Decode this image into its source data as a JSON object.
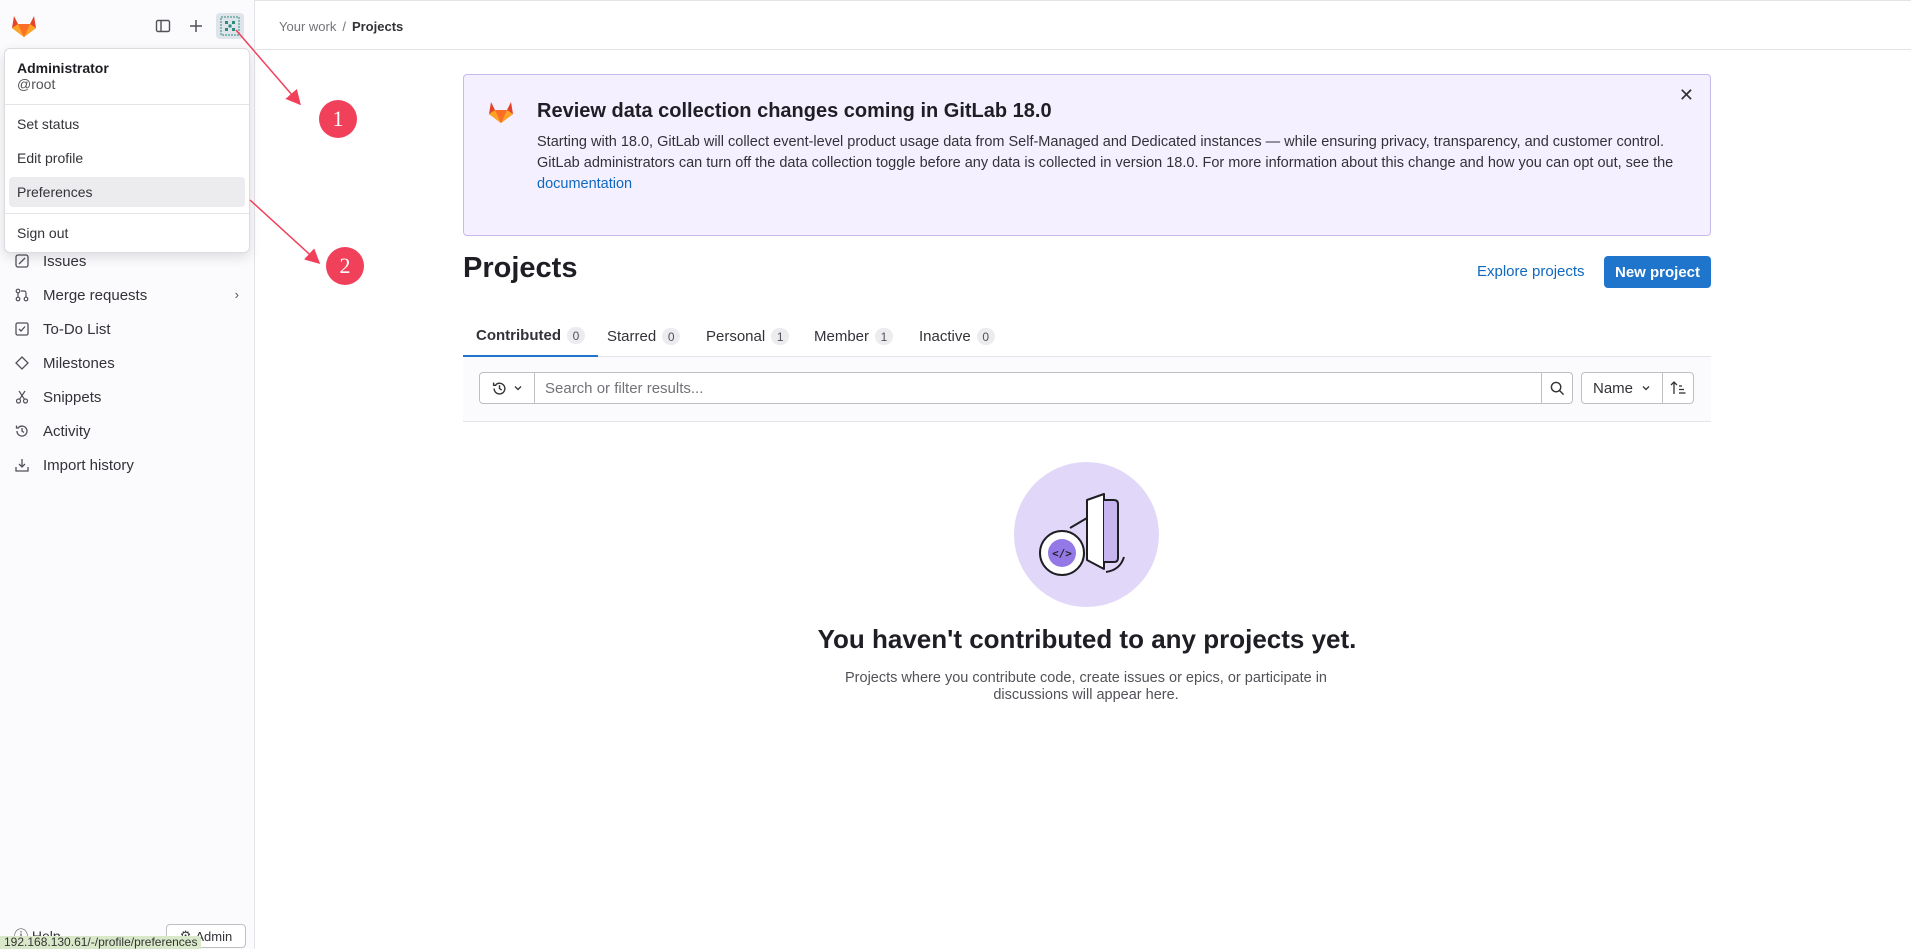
{
  "breadcrumb": {
    "parent": "Your work",
    "separator": "/",
    "current": "Projects"
  },
  "user_menu": {
    "name": "Administrator",
    "handle": "@root",
    "items": [
      "Set status",
      "Edit profile",
      "Preferences"
    ],
    "sign_out": "Sign out"
  },
  "sidebar": {
    "items": [
      {
        "label": "Issues",
        "icon": "issues-icon"
      },
      {
        "label": "Merge requests",
        "icon": "merge-request-icon"
      },
      {
        "label": "To-Do List",
        "icon": "todo-icon"
      },
      {
        "label": "Milestones",
        "icon": "milestone-icon"
      },
      {
        "label": "Snippets",
        "icon": "snippet-icon"
      },
      {
        "label": "Activity",
        "icon": "history-icon"
      },
      {
        "label": "Import history",
        "icon": "import-icon"
      }
    ],
    "help": "Help",
    "admin": "Admin"
  },
  "status_bar_url": "192.168.130.61/-/profile/preferences",
  "banner": {
    "title": "Review data collection changes coming in GitLab 18.0",
    "body": "Starting with 18.0, GitLab will collect event-level product usage data from Self-Managed and Dedicated instances — while ensuring privacy, transparency, and customer control. GitLab administrators can turn off the data collection toggle before any data is collected in version 18.0. For more information about this change and how you can opt out, see the ",
    "link": "documentation"
  },
  "page": {
    "title": "Projects",
    "explore_link": "Explore projects",
    "new_button": "New project"
  },
  "tabs": [
    {
      "label": "Contributed",
      "count": "0",
      "active": true
    },
    {
      "label": "Starred",
      "count": "0"
    },
    {
      "label": "Personal",
      "count": "1"
    },
    {
      "label": "Member",
      "count": "1"
    },
    {
      "label": "Inactive",
      "count": "0"
    }
  ],
  "filter": {
    "search_placeholder": "Search or filter results...",
    "sort_label": "Name"
  },
  "empty_state": {
    "title": "You haven't contributed to any projects yet.",
    "description": "Projects where you contribute code, create issues or epics, or participate in discussions will appear here."
  },
  "annotations": [
    "1",
    "2"
  ],
  "colors": {
    "brand_orange": "#e24329",
    "primary_blue": "#1f75cb",
    "annotation_red": "#f0405a",
    "banner_bg": "#f4f0ff"
  }
}
